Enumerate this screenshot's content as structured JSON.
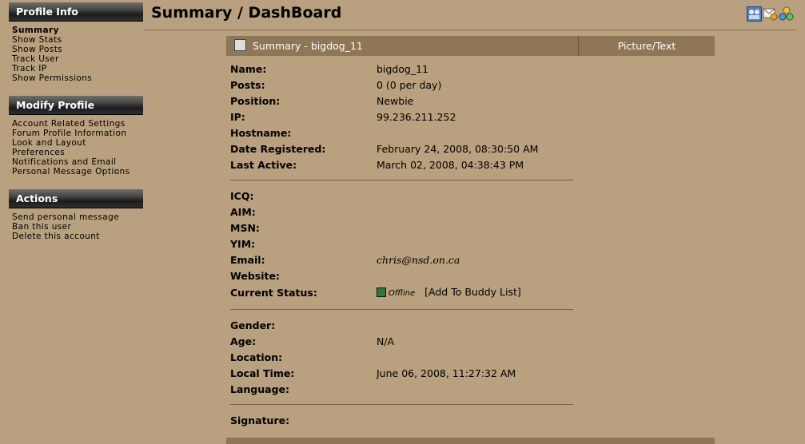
{
  "sidebar": {
    "sections": [
      {
        "title": "Profile Info",
        "items": [
          "Summary",
          "Show Stats",
          "Show Posts",
          "Track User",
          "Track IP",
          "Show Permissions"
        ]
      },
      {
        "title": "Modify Profile",
        "items": [
          "Account Related Settings",
          "Forum Profile Information",
          "Look and Layout",
          "Preferences",
          "Notifications and Email",
          "Personal Message Options"
        ]
      },
      {
        "title": "Actions",
        "items": [
          "Send personal message",
          "Ban this user",
          "Delete this account"
        ]
      }
    ]
  },
  "page": {
    "title": "Summary / DashBoard"
  },
  "header_icons": [
    "group-icon",
    "messages-icon",
    "buddies-icon"
  ],
  "panel": {
    "title": "Summary - bigdog_11",
    "picture_title": "Picture/Text"
  },
  "fields": {
    "name_label": "Name:",
    "name": "bigdog_11",
    "posts_label": "Posts:",
    "posts": "0 (0 per day)",
    "position_label": "Position:",
    "position": "Newbie",
    "ip_label": "IP:",
    "ip": "99.236.211.252",
    "hostname_label": "Hostname:",
    "hostname": "",
    "registered_label": "Date Registered:",
    "registered": "February 24, 2008, 08:30:50 AM",
    "last_active_label": "Last Active:",
    "last_active": "March 02, 2008, 04:38:43 PM",
    "icq_label": "ICQ:",
    "aim_label": "AIM:",
    "msn_label": "MSN:",
    "yim_label": "YIM:",
    "email_label": "Email:",
    "email": "chris@nsd.on.ca",
    "website_label": "Website:",
    "status_label": "Current Status:",
    "status": "Offline",
    "buddy_link": "[Add To Buddy List]",
    "gender_label": "Gender:",
    "age_label": "Age:",
    "age": "N/A",
    "location_label": "Location:",
    "local_time_label": "Local Time:",
    "local_time": "June 06, 2008, 11:27:32 AM",
    "language_label": "Language:",
    "signature_label": "Signature:"
  },
  "colors": {
    "background": "#b9a07e",
    "panel_header": "#8f7656",
    "header_dark": "#1c1c1c"
  }
}
